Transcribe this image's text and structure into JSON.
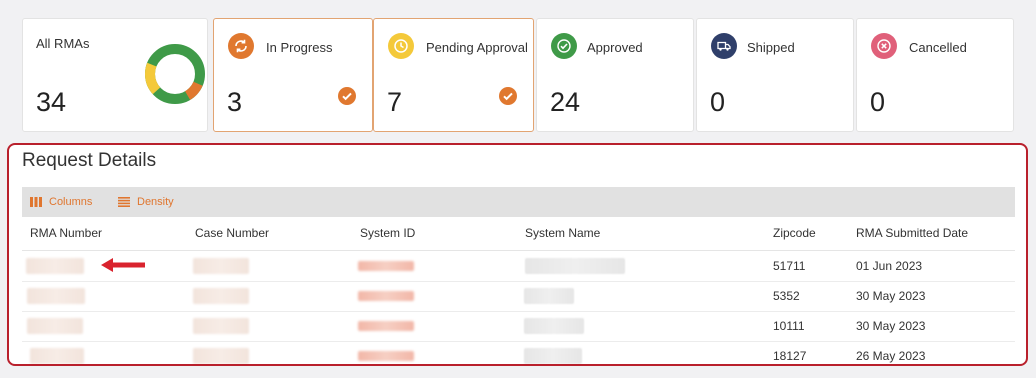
{
  "cards": [
    {
      "key": "all",
      "label": "All RMAs",
      "count": "34",
      "icon": "donut-chart"
    },
    {
      "key": "in_progress",
      "label": "In Progress",
      "count": "3",
      "icon": "sync-icon",
      "color": "#e0782f",
      "active": true,
      "checked": true
    },
    {
      "key": "pending",
      "label": "Pending Approval",
      "count": "7",
      "icon": "clock-icon",
      "color": "#f4c93a",
      "active": true,
      "checked": true
    },
    {
      "key": "approved",
      "label": "Approved",
      "count": "24",
      "icon": "check-circle-icon",
      "color": "#3f9a48"
    },
    {
      "key": "shipped",
      "label": "Shipped",
      "count": "0",
      "icon": "truck-icon",
      "color": "#2f3f6a"
    },
    {
      "key": "cancelled",
      "label": "Cancelled",
      "count": "0",
      "icon": "x-circle-icon",
      "color": "#e0607a"
    }
  ],
  "donut": {
    "green": 0.7,
    "orange": 0.15,
    "yellow": 0.15,
    "colors": {
      "green": "#3f9a48",
      "orange": "#e0782f",
      "yellow": "#f4c93a"
    }
  },
  "details": {
    "title": "Request Details",
    "toolbar": {
      "columns_label": "Columns",
      "density_label": "Density"
    },
    "columns": [
      "RMA Number",
      "Case Number",
      "System ID",
      "System Name",
      "Zipcode",
      "RMA Submitted Date"
    ],
    "rows": [
      {
        "zipcode": "51711",
        "date": "01 Jun 2023"
      },
      {
        "zipcode": "5352",
        "date": "30 May 2023"
      },
      {
        "zipcode": "10111",
        "date": "30 May 2023"
      },
      {
        "zipcode": "18127",
        "date": "26 May 2023"
      }
    ]
  },
  "colors": {
    "accent": "#e0762f",
    "highlight": "#b9202c"
  }
}
